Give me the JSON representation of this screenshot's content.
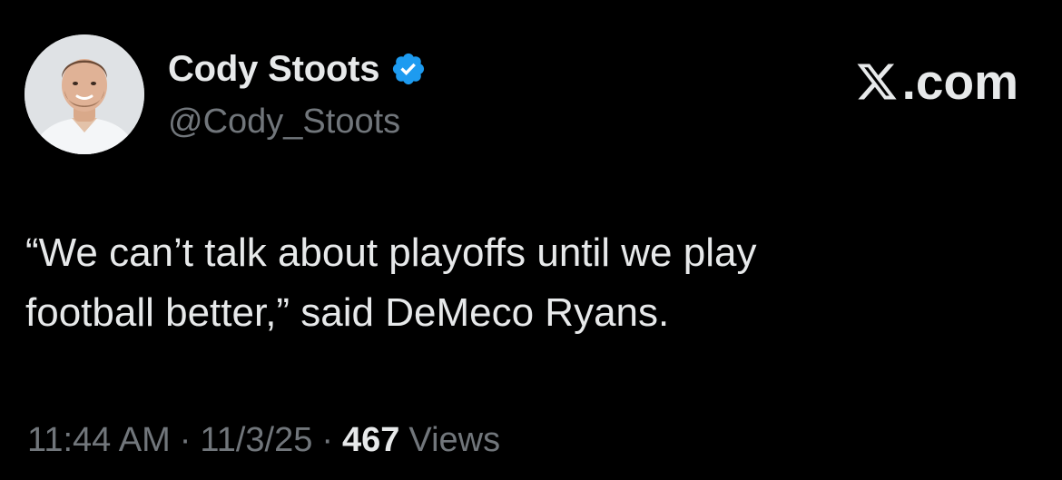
{
  "author": {
    "display_name": "Cody Stoots",
    "handle": "@Cody_Stoots",
    "verified_icon": "verified-badge-icon"
  },
  "brand": {
    "suffix": ".com",
    "icon": "x-logo-icon"
  },
  "tweet": {
    "text": "“We can’t talk about playoffs until we play\nfootball better,” said DeMeco Ryans."
  },
  "meta": {
    "time": "11:44 AM",
    "separator": "·",
    "date": "11/3/25",
    "views_count": "467",
    "views_label": "Views"
  },
  "colors": {
    "background": "#000000",
    "primary_text": "#e7e9ea",
    "secondary_text": "#71767b",
    "verified": "#1d9bf0"
  }
}
